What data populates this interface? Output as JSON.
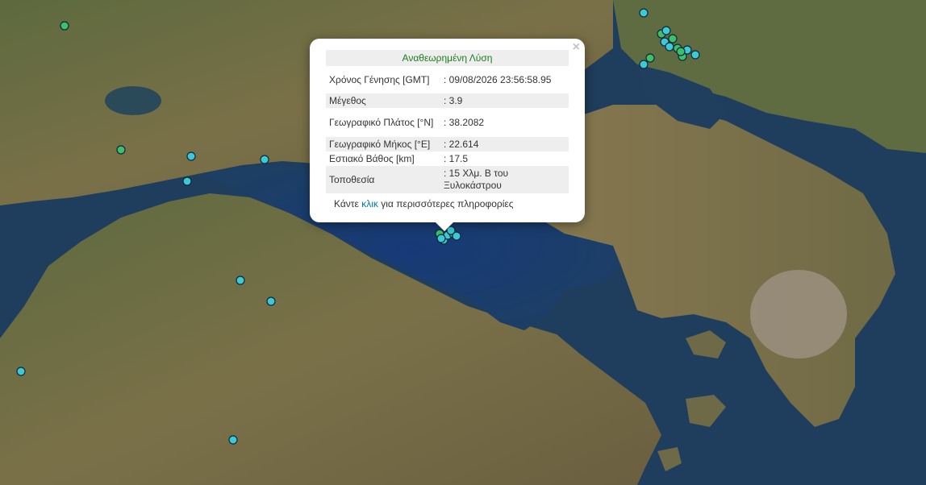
{
  "popup": {
    "title": "Αναθεωρημένη Λύση",
    "close_label": "×",
    "rows": [
      {
        "label": "Χρόνος Γένησης [GMT]",
        "value": ": 09/08/2026 23:56:58.95"
      },
      {
        "label": "Μέγεθος",
        "value": ": 3.9"
      },
      {
        "label": "Γεωγραφικό Πλάτος [°N]",
        "value": ": 38.2082"
      },
      {
        "label": "Γεωγραφικό Μήκος [°E]",
        "value": ": 22.614"
      },
      {
        "label": "Εστιακό Βάθος [km]",
        "value": ": 17.5"
      },
      {
        "label": "Τοποθεσία",
        "value": ": 15 Χλμ. Β του Ξυλοκάστρου"
      }
    ],
    "more_prefix": "Κάντε",
    "more_link": "κλικ",
    "more_suffix": "για περισσότερες πληροφορίες"
  },
  "colors": {
    "sea": "#1f3d5c",
    "land": "#6b6a45",
    "marker_cyan": "#3ec9d6",
    "marker_green": "#3fbf6a",
    "title_green": "#1e7a1e",
    "link_blue": "#0078a8"
  },
  "markers": [
    {
      "id": "m1",
      "color": "green"
    },
    {
      "id": "m2",
      "color": "green"
    },
    {
      "id": "m3",
      "color": "cyan"
    },
    {
      "id": "m4",
      "color": "cyan"
    },
    {
      "id": "m5",
      "color": "cyan"
    },
    {
      "id": "m6",
      "color": "cyan"
    },
    {
      "id": "m7",
      "color": "cyan"
    },
    {
      "id": "m8",
      "color": "cyan"
    },
    {
      "id": "m9",
      "color": "cyan"
    },
    {
      "id": "m10",
      "color": "cyan"
    },
    {
      "id": "m11",
      "color": "cyan"
    },
    {
      "id": "m12",
      "color": "green"
    },
    {
      "id": "m13",
      "color": "green"
    },
    {
      "id": "m14",
      "color": "cyan"
    },
    {
      "id": "m15",
      "color": "cyan"
    },
    {
      "id": "m16",
      "color": "green"
    },
    {
      "id": "m17",
      "color": "cyan"
    },
    {
      "id": "m18",
      "color": "green"
    },
    {
      "id": "m19",
      "color": "green"
    },
    {
      "id": "m20",
      "color": "cyan"
    },
    {
      "id": "m21",
      "color": "green"
    },
    {
      "id": "m22",
      "color": "cyan"
    },
    {
      "id": "m23",
      "color": "green"
    },
    {
      "id": "m24",
      "color": "cyan"
    },
    {
      "id": "m25",
      "color": "cyan"
    },
    {
      "id": "m26",
      "color": "green"
    },
    {
      "id": "m27",
      "color": "cyan"
    },
    {
      "id": "m28",
      "color": "cyan"
    },
    {
      "id": "m29",
      "color": "cyan"
    }
  ]
}
